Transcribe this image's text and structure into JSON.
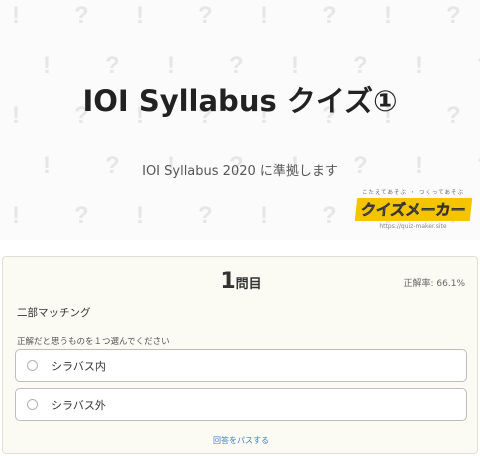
{
  "hero": {
    "title": "IOI Syllabus クイズ①",
    "subtitle": "IOI Syllabus 2020 に準拠します",
    "pattern_glyph_a": "!",
    "pattern_glyph_b": "?"
  },
  "logo": {
    "tagline": "こたえてあそぶ ・ つくってあそぶ",
    "name": "クイズメーカー",
    "url": "https://quiz-maker.site"
  },
  "quiz": {
    "number": "1",
    "number_suffix": "問目",
    "accuracy_label": "正解率: 66.1%",
    "title": "二部マッチング",
    "instruction": "正解だと思うものを１つ選んでください",
    "choices": [
      {
        "label": "シラバス内"
      },
      {
        "label": "シラバス外"
      }
    ],
    "pass_label": "回答をパスする"
  },
  "colors": {
    "card_background": "#fbfaf3",
    "logo_accent": "#f5c400",
    "link": "#3a7bd5"
  }
}
